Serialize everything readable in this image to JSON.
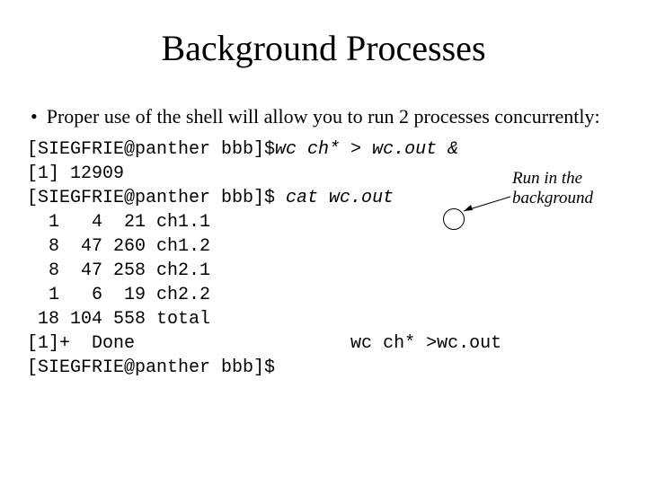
{
  "title": "Background Processes",
  "bullet": {
    "text": "Proper use of the shell will allow you to run 2 processes concurrently:"
  },
  "annotation": {
    "run_bg_line1": "Run in the",
    "run_bg_line2": "background"
  },
  "terminal": {
    "l1_prompt": "[SIEGFRIE@panther bbb]$",
    "l1_cmd": "wc ch* > wc.out &",
    "l2": "[1] 12909",
    "l3_prompt": "[SIEGFRIE@panther bbb]$ ",
    "l3_cmd": "cat wc.out",
    "l4": "  1   4  21 ch1.1",
    "l5": "  8  47 260 ch1.2",
    "l6": "  8  47 258 ch2.1",
    "l7": "  1   6  19 ch2.2",
    "l8": " 18 104 558 total",
    "l9": "[1]+  Done                    wc ch* >wc.out",
    "l10": "[SIEGFRIE@panther bbb]$"
  }
}
